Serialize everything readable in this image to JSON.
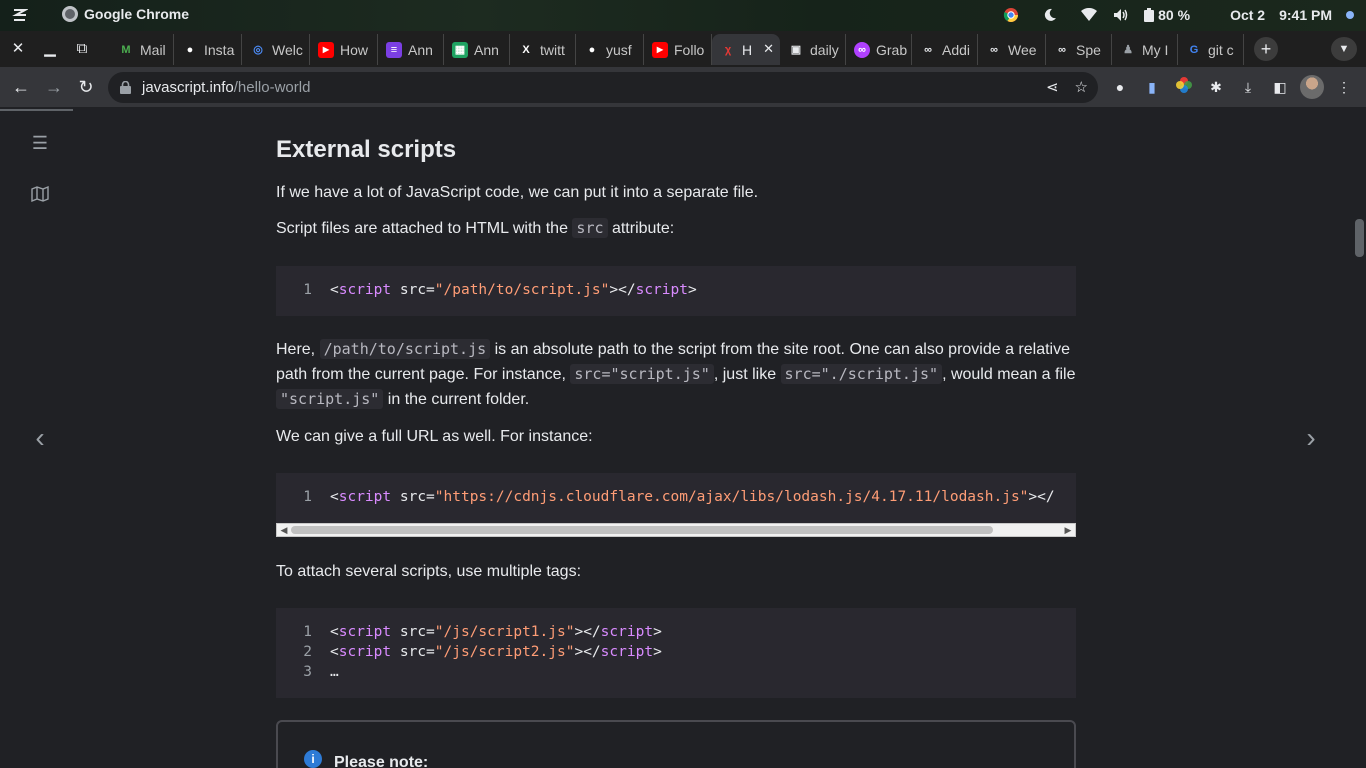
{
  "os": {
    "app_name": "Google Chrome",
    "battery": "80 %",
    "date": "Oct 2",
    "time": "9:41 PM"
  },
  "tabs": [
    {
      "label": "Mail",
      "icon": "mail-icon",
      "color": "#4caf50"
    },
    {
      "label": "Insta",
      "icon": "github-icon",
      "color": "#ffffff"
    },
    {
      "label": "Welc",
      "icon": "welcome-icon",
      "color": "#4c8bf5"
    },
    {
      "label": "How",
      "icon": "youtube-icon",
      "color": "#ff0000"
    },
    {
      "label": "Ann",
      "icon": "forms-icon",
      "color": "#7b3fe4"
    },
    {
      "label": "Ann",
      "icon": "sheets-icon",
      "color": "#1ea362"
    },
    {
      "label": "twitt",
      "icon": "x-icon",
      "color": "#ffffff"
    },
    {
      "label": "yusf",
      "icon": "github-icon",
      "color": "#ffffff"
    },
    {
      "label": "Follo",
      "icon": "youtube-icon",
      "color": "#ff0000"
    },
    {
      "label": "H",
      "icon": "javascript-info-icon",
      "color": "#e53935",
      "active": true
    },
    {
      "label": "daily",
      "icon": "calendar-icon",
      "color": "#e8eaed"
    },
    {
      "label": "Grab",
      "icon": "grab-icon",
      "color": "#b040ff"
    },
    {
      "label": "Addi",
      "icon": "link-icon",
      "color": "#e8eaed"
    },
    {
      "label": "Wee",
      "icon": "link-icon",
      "color": "#e8eaed"
    },
    {
      "label": "Spe",
      "icon": "link-icon",
      "color": "#e8eaed"
    },
    {
      "label": "My I",
      "icon": "profile-icon",
      "color": "#9aa0a6"
    },
    {
      "label": "git c",
      "icon": "google-icon",
      "color": "#4285f4"
    }
  ],
  "address_bar": {
    "host": "javascript.info",
    "path": "/hello-world"
  },
  "article": {
    "heading": "External scripts",
    "p1": "If we have a lot of JavaScript code, we can put it into a separate file.",
    "p2_before": "Script files are attached to HTML with the ",
    "p2_code": "src",
    "p2_after": " attribute:",
    "code1": {
      "line_no": "1",
      "tag_open": "script",
      "attr": " src=",
      "value": "\"/path/to/script.js\"",
      "tag_close": "script"
    },
    "p3": {
      "t1": "Here, ",
      "c1": "/path/to/script.js",
      "t2": " is an absolute path to the script from the site root. One can also provide a relative path from the current page. For instance, ",
      "c2": "src=\"script.js\"",
      "t3": ", just like ",
      "c3": "src=\"./script.js\"",
      "t4": ", would mean a file ",
      "c4": "\"script.js\"",
      "t5": " in the current folder."
    },
    "p4": "We can give a full URL as well. For instance:",
    "code2": {
      "line_no": "1",
      "tag_open": "script",
      "attr": " src=",
      "value": "\"https://cdnjs.cloudflare.com/ajax/libs/lodash.js/4.17.11/lodash.js\"",
      "tail": "></"
    },
    "p5": "To attach several scripts, use multiple tags:",
    "code3": {
      "lines": [
        {
          "n": "1",
          "value": "\"/js/script1.js\""
        },
        {
          "n": "2",
          "value": "\"/js/script2.js\""
        }
      ],
      "line3_n": "3",
      "line3_text": "…",
      "tag": "script",
      "attr": " src="
    },
    "note_title": "Please note:"
  }
}
